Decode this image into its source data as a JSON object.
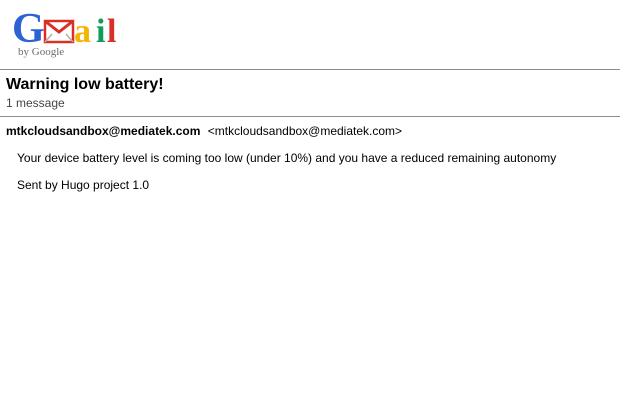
{
  "brand": {
    "logo_text": "Gmail",
    "byline": "by Google",
    "colors": {
      "blue": "#2d62d4",
      "red": "#d93025",
      "yellow": "#f4b400",
      "green": "#0f9d58"
    }
  },
  "message": {
    "subject": "Warning low battery!",
    "count_label": "1 message",
    "sender_name": "mtkcloudsandbox@mediatek.com",
    "sender_email": "<mtkcloudsandbox@mediatek.com>",
    "body": "Your device battery level is coming too low (under 10%) and you have a reduced remaining autonomy",
    "signature": "Sent by Hugo project 1.0"
  },
  "icons": {
    "logo": "gmail-logo"
  }
}
